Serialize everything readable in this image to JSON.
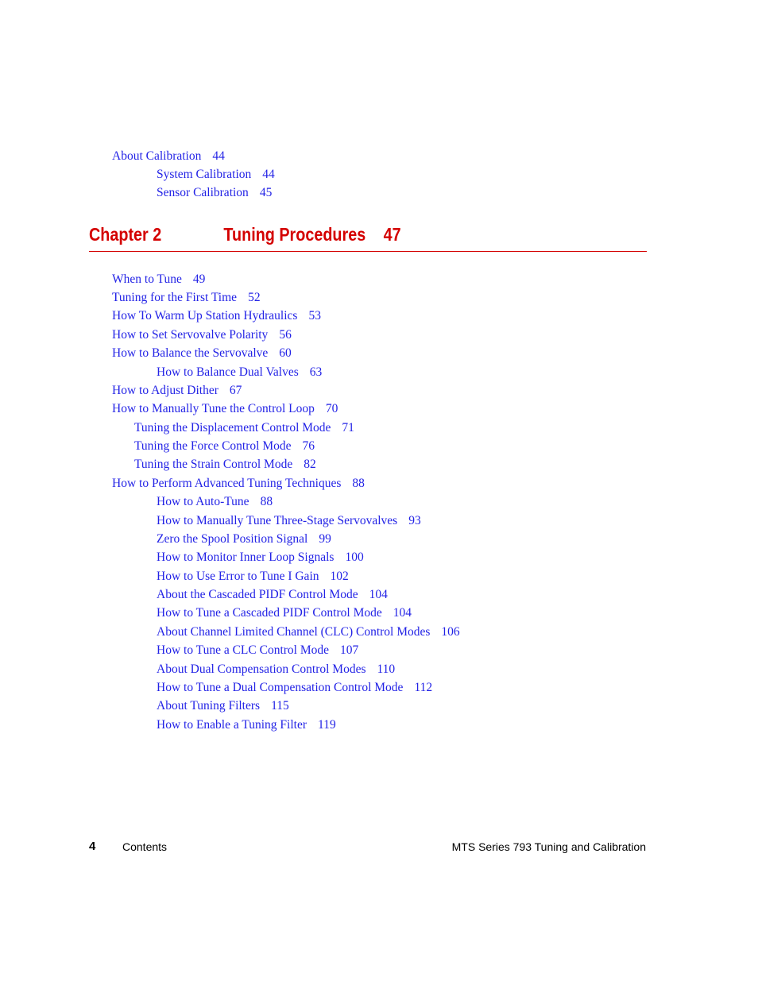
{
  "pre_entries": [
    {
      "title": "About Calibration",
      "page": "44"
    },
    {
      "title": "System Calibration",
      "page": "44"
    },
    {
      "title": "Sensor Calibration",
      "page": "45"
    }
  ],
  "chapter": {
    "label": "Chapter 2",
    "title": "Tuning Procedures",
    "page": "47",
    "color": "#d40000"
  },
  "entries": [
    {
      "title": "When to Tune",
      "page": "49"
    },
    {
      "title": "Tuning for the First Time",
      "page": "52"
    },
    {
      "title": "How To Warm Up Station Hydraulics",
      "page": "53"
    },
    {
      "title": "How to Set Servovalve Polarity",
      "page": "56"
    },
    {
      "title": "How to Balance the Servovalve",
      "page": "60"
    },
    {
      "title": "How to Balance Dual Valves",
      "page": "63"
    },
    {
      "title": "How to Adjust Dither",
      "page": "67"
    },
    {
      "title": "How to Manually Tune the Control Loop",
      "page": "70"
    },
    {
      "title": "Tuning the Displacement Control Mode",
      "page": "71"
    },
    {
      "title": "Tuning the Force Control Mode",
      "page": "76"
    },
    {
      "title": "Tuning the Strain Control Mode",
      "page": "82"
    },
    {
      "title": "How to Perform Advanced Tuning Techniques",
      "page": "88"
    },
    {
      "title": "How to Auto-Tune",
      "page": "88"
    },
    {
      "title": "How to Manually Tune Three-Stage Servovalves",
      "page": "93"
    },
    {
      "title": "Zero the Spool Position Signal",
      "page": "99"
    },
    {
      "title": "How to Monitor Inner Loop Signals",
      "page": "100"
    },
    {
      "title": "How to Use Error to Tune I Gain",
      "page": "102"
    },
    {
      "title": "About the Cascaded PIDF Control Mode",
      "page": "104"
    },
    {
      "title": "How to Tune a Cascaded PIDF Control Mode",
      "page": "104"
    },
    {
      "title": "About Channel Limited Channel (CLC) Control Modes",
      "page": "106"
    },
    {
      "title": "How to Tune a CLC Control Mode",
      "page": "107"
    },
    {
      "title": "About Dual Compensation Control Modes",
      "page": "110"
    },
    {
      "title": "How to Tune a Dual Compensation Control Mode",
      "page": "112"
    },
    {
      "title": "About Tuning Filters",
      "page": "115"
    },
    {
      "title": "How to Enable a Tuning Filter",
      "page": "119"
    }
  ],
  "footer": {
    "page_number": "4",
    "section": "Contents",
    "document_title": "MTS Series 793 Tuning and Calibration"
  },
  "colors": {
    "link": "#2323e6",
    "chapter": "#d40000"
  }
}
